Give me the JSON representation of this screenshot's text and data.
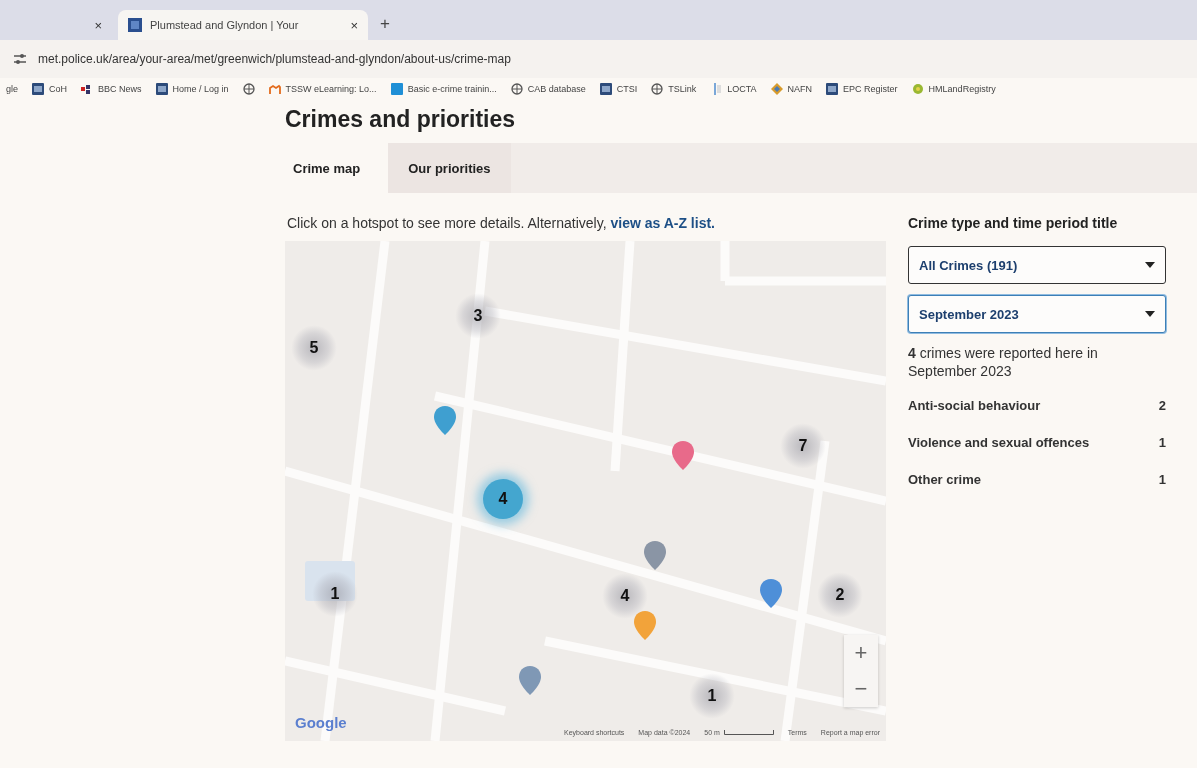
{
  "browser": {
    "tabs": [
      {
        "close": "×",
        "selected": false
      },
      {
        "title": "Plumstead and Glyndon | Your",
        "close": "×",
        "selected": true
      }
    ],
    "new_tab": "+",
    "address": "met.police.uk/area/your-area/met/greenwich/plumstead-and-glyndon/about-us/crime-map",
    "bookmarks": [
      {
        "label": "gle",
        "kind": "text"
      },
      {
        "label": "CoH",
        "kind": "square"
      },
      {
        "label": "BBC News",
        "kind": "bbc"
      },
      {
        "label": "Home / Log in",
        "kind": "square"
      },
      {
        "kind": "globe"
      },
      {
        "label": "TSSW eLearning: Lo...",
        "kind": "moodle"
      },
      {
        "label": "Basic e-crime trainin...",
        "kind": "edge"
      },
      {
        "label": "CAB database",
        "kind": "globe"
      },
      {
        "label": "CTSI",
        "kind": "square"
      },
      {
        "label": "TSLink",
        "kind": "globe"
      },
      {
        "label": "LOCTA",
        "kind": "bar"
      },
      {
        "label": "NAFN",
        "kind": "diamond"
      },
      {
        "label": "EPC Register",
        "kind": "square"
      },
      {
        "label": "HMLandRegistry",
        "kind": "flower"
      }
    ]
  },
  "page": {
    "heading": "Crimes and priorities",
    "tabs": [
      {
        "label": "Crime map",
        "selected": true
      },
      {
        "label": "Our priorities",
        "selected": false
      }
    ],
    "intro": "Click on a hotspot to see more details. Alternatively, ",
    "intro_link": "view as A-Z list.",
    "map": {
      "hotspots": [
        {
          "count": "3",
          "selected": false
        },
        {
          "count": "5",
          "selected": false
        },
        {
          "count": "7",
          "selected": false
        },
        {
          "count": "4",
          "selected": true
        },
        {
          "count": "1",
          "selected": false
        },
        {
          "count": "4",
          "selected": false
        },
        {
          "count": "2",
          "selected": false
        },
        {
          "count": "1",
          "selected": false
        }
      ],
      "zoom_in": "+",
      "zoom_out": "−",
      "logo": "Google",
      "attribution": [
        "Keyboard shortcuts",
        "Map data ©2024",
        "50 m",
        "Terms",
        "Report a map error"
      ]
    },
    "sidebar": {
      "title": "Crime type and time period title",
      "selects": [
        {
          "value": "All Crimes (191)",
          "focused": false
        },
        {
          "value": "September 2023",
          "focused": true
        }
      ],
      "summary": "**4** crimes were reported here in September 2023",
      "breakdown": [
        {
          "label": "Anti-social behaviour",
          "count": "2"
        },
        {
          "label": "Violence and sexual offences",
          "count": "1"
        },
        {
          "label": "Other crime",
          "count": "1"
        }
      ]
    }
  }
}
